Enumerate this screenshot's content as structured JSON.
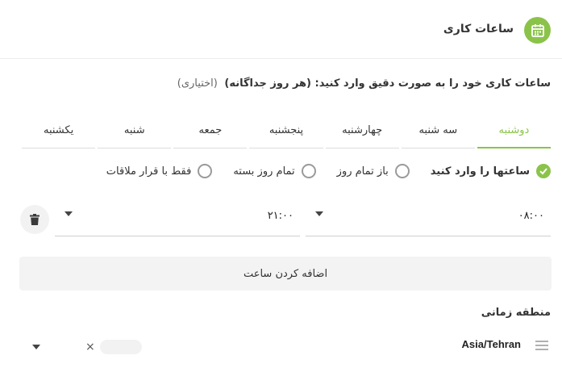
{
  "header": {
    "title": "ساعات کاری",
    "icon": "calendar-icon"
  },
  "instructions": {
    "text": "ساعات کاری خود را به صورت دقیق وارد کنید: (هر روز جداگانه)",
    "optional": "(اختیاری)"
  },
  "tabs": [
    {
      "label": "دوشنبه",
      "active": true
    },
    {
      "label": "سه شنبه",
      "active": false
    },
    {
      "label": "چهارشنبه",
      "active": false
    },
    {
      "label": "پنجشنبه",
      "active": false
    },
    {
      "label": "جمعه",
      "active": false
    },
    {
      "label": "شنبه",
      "active": false
    },
    {
      "label": "یکشنبه",
      "active": false
    }
  ],
  "modes": [
    {
      "label": "ساعتها را وارد کنید",
      "checked": true
    },
    {
      "label": "باز تمام روز",
      "checked": false
    },
    {
      "label": "تمام روز بسته",
      "checked": false
    },
    {
      "label": "فقط با قرار ملاقات",
      "checked": false
    }
  ],
  "hours": {
    "from": "۰۸:۰۰",
    "to": "۲۱:۰۰"
  },
  "add_button": "اضافه کردن ساعت",
  "timezone": {
    "label": "منطقه زمانی",
    "value": "Asia/Tehran",
    "clear": "×"
  },
  "colors": {
    "accent": "#8bc34a"
  }
}
